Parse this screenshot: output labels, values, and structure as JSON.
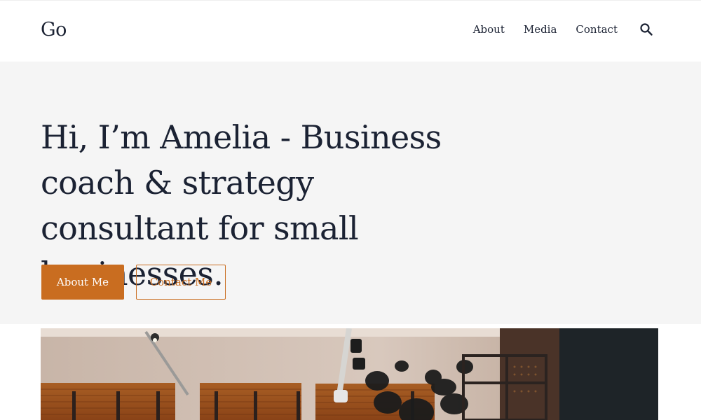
{
  "header": {
    "logo": "Go",
    "nav": [
      {
        "label": "About"
      },
      {
        "label": "Media"
      },
      {
        "label": "Contact"
      }
    ],
    "search_icon": "search-icon"
  },
  "hero": {
    "title": "Hi, I’m Amelia - Business coach & strategy consultant for small businesses.",
    "primary_button": "About Me",
    "secondary_button": "Contact Me"
  },
  "colors": {
    "accent": "#c96d20",
    "text": "#1b2233",
    "hero_background": "#f5f5f5"
  },
  "image": {
    "description_icon": "office-photo"
  }
}
